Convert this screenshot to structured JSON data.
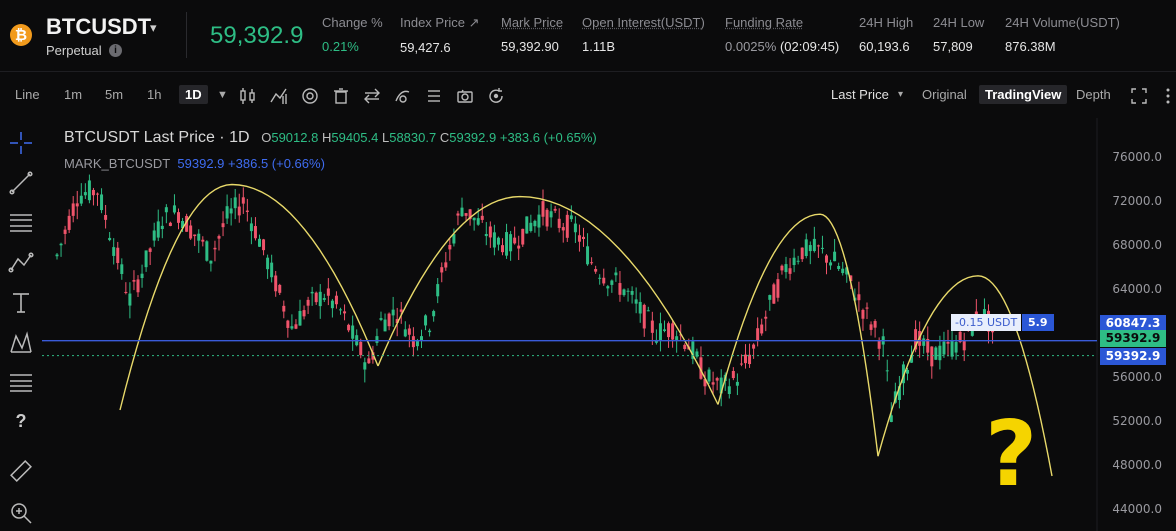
{
  "header": {
    "coin_glyph": "₿",
    "symbol": "BTCUSDT",
    "caret": "▾",
    "contract_type": "Perpetual",
    "info_glyph": "i",
    "last_price": "59,392.9",
    "stats": [
      {
        "label": "Change %",
        "value": "0.21%",
        "green": true
      },
      {
        "label": "Index Price ↗",
        "value": "59,427.6"
      },
      {
        "label": "Mark Price",
        "value": "59,392.90"
      },
      {
        "label": "Open Interest(USDT)",
        "value": "1.11B"
      },
      {
        "label": "Funding Rate",
        "value": "0.0025%",
        "value2": "(02:09:45)"
      },
      {
        "label": "24H High",
        "value": "60,193.6"
      },
      {
        "label": "24H Low",
        "value": "57,809"
      },
      {
        "label": "24H Volume(USDT)",
        "value": "876.38M"
      }
    ]
  },
  "toolbar": {
    "line": "Line",
    "m1": "1m",
    "m5": "5m",
    "h1": "1h",
    "d1": "1D",
    "price_mode": "Last Price",
    "price_caret": "▾",
    "original": "Original",
    "tradingview": "TradingView",
    "depth": "Depth"
  },
  "legend": {
    "title": "BTCUSDT Last Price · 1D",
    "o_label": "O",
    "o": "59012.8",
    "h_label": "H",
    "h": "59405.4",
    "l_label": "L",
    "l": "58830.7",
    "c_label": "C",
    "c": "59392.9",
    "chg": "+383.6 (+0.65%)",
    "mark_label": "MARK_BTCUSDT",
    "mark_val": "59392.9",
    "mark_chg": "+386.5 (+0.66%)"
  },
  "yaxis": [
    "76000.0",
    "72000.0",
    "68000.0",
    "64000.0",
    "60000.0",
    "56000.0",
    "52000.0",
    "48000.0",
    "44000.0"
  ],
  "price_tags": {
    "blue_line": "60847.3",
    "last_green": "59392.9",
    "mark_blue": "59392.9"
  },
  "order": {
    "pnl": "-0.15 USDT",
    "qty": "5.9"
  },
  "annotation": {
    "qmark": "?"
  },
  "sidebar_help": "?",
  "colors": {
    "up": "#2ebd85",
    "down": "#f0546b",
    "accent_blue": "#2b57d6",
    "arc_yellow": "#e8d96a",
    "qmark_yellow": "#f5d400"
  },
  "chart_data": {
    "type": "candlestick",
    "ylim": [
      42000,
      78000
    ],
    "arcs": [
      {
        "from": 53000,
        "peak": 73500,
        "to": 57000
      },
      {
        "from": 57000,
        "peak": 72400,
        "to": 53500
      },
      {
        "from": 53500,
        "peak": 70800,
        "to": 48800
      },
      {
        "from": 48800,
        "peak": 65200,
        "to": 47000
      }
    ],
    "horizontal_levels": [
      60847.3,
      59392.9
    ]
  }
}
